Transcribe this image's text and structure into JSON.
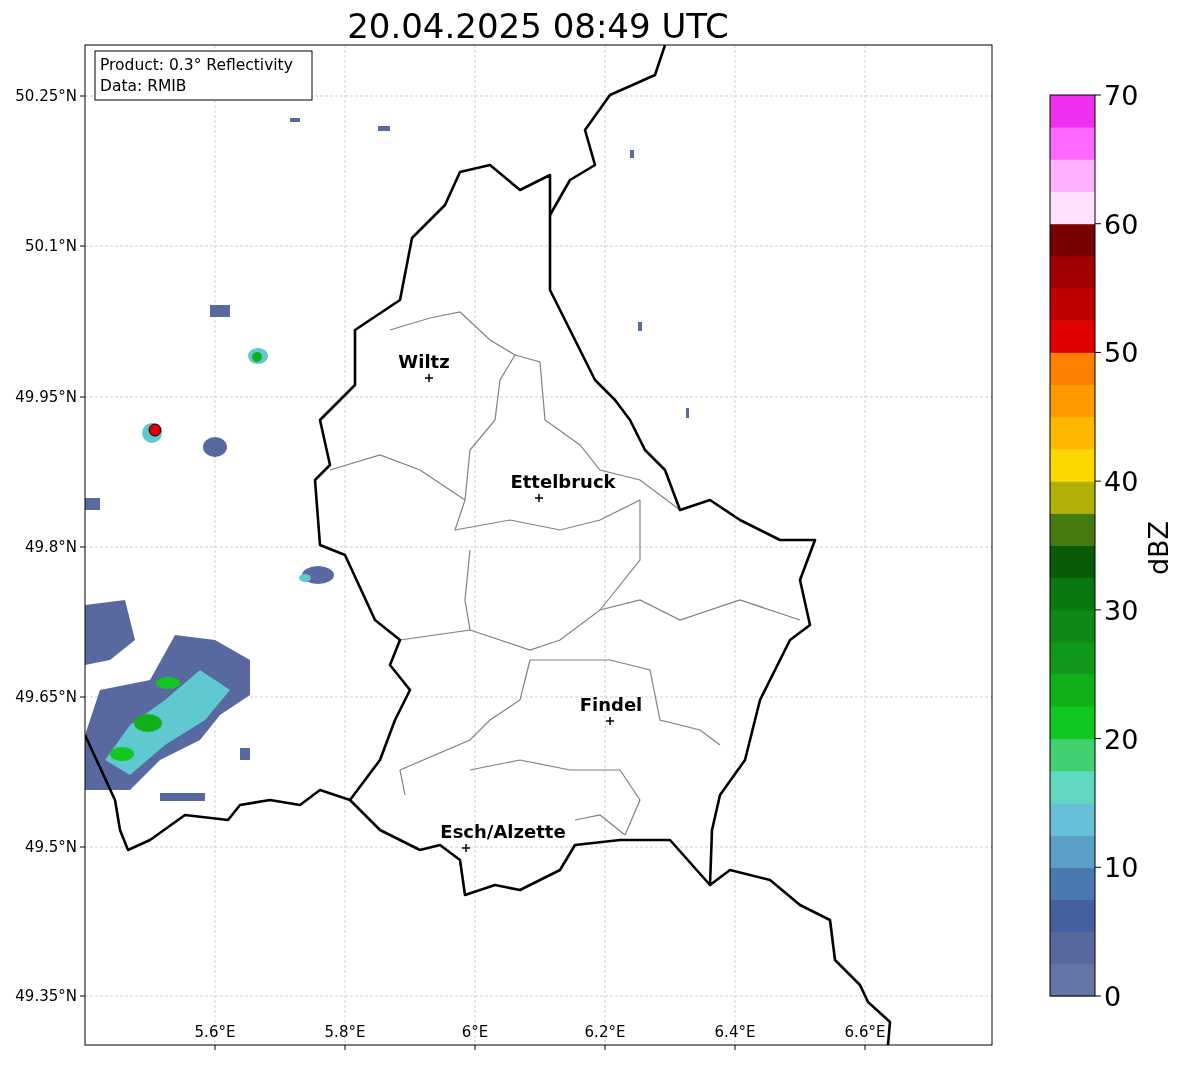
{
  "title": "20.04.2025 08:49 UTC",
  "info_box": [
    "Product: 0.3° Reflectivity",
    "Data: RMIB"
  ],
  "map": {
    "lat_labels": [
      "50.25°N",
      "50.1°N",
      "49.95°N",
      "49.8°N",
      "49.65°N",
      "49.5°N",
      "49.35°N"
    ],
    "lon_labels": [
      "5.6°E",
      "5.8°E",
      "6°E",
      "6.2°E",
      "6.4°E",
      "6.6°E"
    ],
    "cities": [
      {
        "name": "Wiltz"
      },
      {
        "name": "Ettelbruck"
      },
      {
        "name": "Findel"
      },
      {
        "name": "Esch/Alzette"
      }
    ]
  },
  "colorbar": {
    "label": "dBZ",
    "ticks": [
      "70",
      "60",
      "50",
      "40",
      "30",
      "20",
      "10",
      "0"
    ],
    "segments": [
      {
        "color": "#6475a8"
      },
      {
        "color": "#5869a0"
      },
      {
        "color": "#4560a0"
      },
      {
        "color": "#4a78b0"
      },
      {
        "color": "#5aa0c8"
      },
      {
        "color": "#68c0d8"
      },
      {
        "color": "#60d8c0"
      },
      {
        "color": "#40d070"
      },
      {
        "color": "#10c820"
      },
      {
        "color": "#10b018"
      },
      {
        "color": "#109818"
      },
      {
        "color": "#108818"
      },
      {
        "color": "#0a7810"
      },
      {
        "color": "#085c08"
      },
      {
        "color": "#447a10"
      },
      {
        "color": "#b0b008"
      },
      {
        "color": "#ffd700"
      },
      {
        "color": "#ffb800"
      },
      {
        "color": "#ff9a00"
      },
      {
        "color": "#ff8000"
      },
      {
        "color": "#e00000"
      },
      {
        "color": "#c00000"
      },
      {
        "color": "#a00000"
      },
      {
        "color": "#780000"
      },
      {
        "color": "#ffe0ff"
      },
      {
        "color": "#ffb0ff"
      },
      {
        "color": "#ff68ff"
      },
      {
        "color": "#f030f0"
      }
    ]
  }
}
